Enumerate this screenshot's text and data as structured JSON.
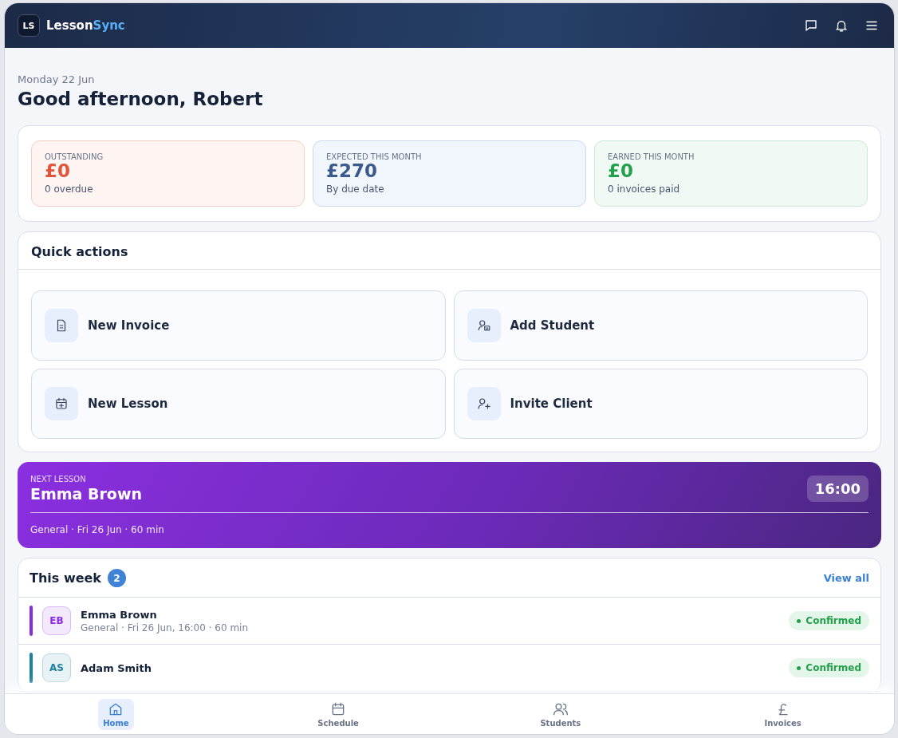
{
  "header": {
    "logo_mark": "LS",
    "brand_first": "Lesson",
    "brand_second": "Sync"
  },
  "greeting": {
    "date": "Monday 22 Jun",
    "title": "Good afternoon, Robert"
  },
  "stats": [
    {
      "kind": "warning",
      "label": "OUTSTANDING",
      "value": "£0",
      "note": "0 overdue"
    },
    {
      "kind": "info",
      "label": "EXPECTED THIS MONTH",
      "value": "£270",
      "note": "By due date"
    },
    {
      "kind": "success",
      "label": "EARNED THIS MONTH",
      "value": "£0",
      "note": "0 invoices paid"
    }
  ],
  "quick_actions": {
    "title": "Quick actions",
    "items": [
      {
        "kind": "invoice",
        "label": "New Invoice"
      },
      {
        "kind": "student",
        "label": "Add Student"
      },
      {
        "kind": "lesson",
        "label": "New Lesson"
      },
      {
        "kind": "client",
        "label": "Invite Client"
      }
    ]
  },
  "next_lesson": {
    "label": "NEXT LESSON",
    "name": "Emma Brown",
    "time": "16:00",
    "details": "General · Fri 26 Jun · 60 min"
  },
  "this_week": {
    "title": "This week",
    "count": "2",
    "link": "View all",
    "lessons": [
      {
        "initials": "EB",
        "name": "Emma Brown",
        "details": "General · Fri 26 Jun, 16:00 · 60 min",
        "status": "Confirmed",
        "color": "#8a2be2"
      },
      {
        "initials": "AS",
        "name": "Adam Smith",
        "status": "Confirmed",
        "color": "#1a82a0"
      }
    ]
  },
  "nav": [
    {
      "kind": "home",
      "label": "Home",
      "selected": true
    },
    {
      "kind": "schedule",
      "label": "Schedule",
      "selected": false
    },
    {
      "kind": "students",
      "label": "Students",
      "selected": false
    },
    {
      "kind": "invoices",
      "label": "Invoices",
      "selected": false
    }
  ]
}
